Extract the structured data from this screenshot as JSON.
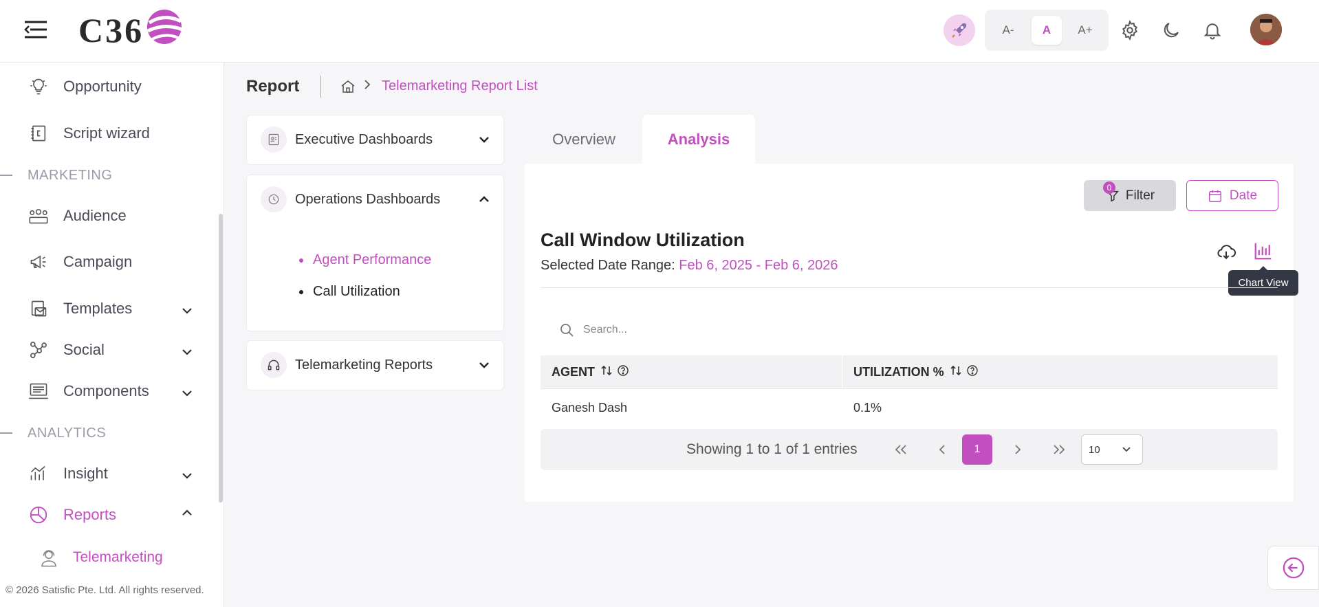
{
  "header": {
    "logo_text": "C36",
    "font_small": "A-",
    "font_normal": "A",
    "font_large": "A+"
  },
  "sidebar": {
    "items": [
      {
        "label": "Opportunity",
        "icon": "lightbulb-icon"
      },
      {
        "label": "Script wizard",
        "icon": "script-icon"
      },
      {
        "label": "Audience",
        "icon": "audience-icon"
      },
      {
        "label": "Campaign",
        "icon": "megaphone-icon"
      },
      {
        "label": "Templates",
        "icon": "templates-icon"
      },
      {
        "label": "Social",
        "icon": "social-icon"
      },
      {
        "label": "Components",
        "icon": "components-icon"
      },
      {
        "label": "Insight",
        "icon": "insight-icon"
      },
      {
        "label": "Reports",
        "icon": "pie-chart-icon"
      }
    ],
    "sections": {
      "marketing": "MARKETING",
      "analytics": "ANALYTICS"
    },
    "sub_item": "Telemarketing",
    "footer": "© 2026 Satisfic Pte. Ltd. All rights reserved."
  },
  "breadcrumb": {
    "title": "Report",
    "current": "Telemarketing Report List"
  },
  "dashboards": {
    "executive": "Executive Dashboards",
    "operations": "Operations Dashboards",
    "operations_items": [
      "Agent Performance",
      "Call Utilization"
    ],
    "telemarketing": "Telemarketing Reports"
  },
  "tabs": {
    "overview": "Overview",
    "analysis": "Analysis"
  },
  "toolbar": {
    "filter_label": "Filter",
    "filter_count": "0",
    "date_label": "Date"
  },
  "report": {
    "title": "Call Window Utilization",
    "date_range_label": "Selected Date Range:",
    "date_range_value": "Feb 6, 2025 - Feb 6, 2026",
    "tooltip": "Chart View"
  },
  "search": {
    "placeholder": "Search..."
  },
  "table": {
    "headers": [
      "AGENT",
      "UTILIZATION %"
    ],
    "rows": [
      [
        "Ganesh Dash",
        "0.1%"
      ]
    ]
  },
  "pagination": {
    "info": "Showing 1 to 1 of 1 entries",
    "current_page": "1",
    "page_size": "10"
  },
  "colors": {
    "accent": "#c24fc0",
    "background": "#f6f6f8"
  }
}
